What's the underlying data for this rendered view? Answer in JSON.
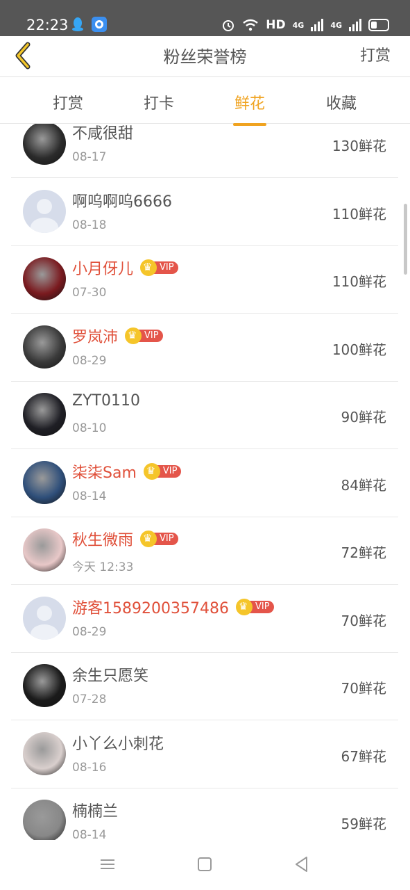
{
  "status": {
    "time": "22:23",
    "hd": "HD",
    "net1": "4G",
    "net2": "4G"
  },
  "header": {
    "title": "粉丝荣誉榜",
    "action": "打赏"
  },
  "tabs": [
    "打赏",
    "打卡",
    "鲜花",
    "收藏"
  ],
  "active_tab": 2,
  "vip_label": "VIP",
  "rows": [
    {
      "name": "不咸很甜",
      "date": "08-17",
      "count": "130鲜花",
      "vip": false,
      "avatar_color": "#2b2b2b"
    },
    {
      "name": "啊呜啊呜6666",
      "date": "08-18",
      "count": "110鲜花",
      "vip": false,
      "avatar_color": "#d6dcea"
    },
    {
      "name": "小月伢儿",
      "date": "07-30",
      "count": "110鲜花",
      "vip": true,
      "avatar_color": "#7a1a1f"
    },
    {
      "name": "罗岚沛",
      "date": "08-29",
      "count": "100鲜花",
      "vip": true,
      "avatar_color": "#3a3a3a"
    },
    {
      "name": "ZYT0110",
      "date": "08-10",
      "count": "90鲜花",
      "vip": false,
      "avatar_color": "#1f1f25"
    },
    {
      "name": "柒柒Sam",
      "date": "08-14",
      "count": "84鲜花",
      "vip": true,
      "avatar_color": "#2f4f7a"
    },
    {
      "name": "秋生微雨",
      "date": "今天 12:33",
      "count": "72鲜花",
      "vip": true,
      "avatar_color": "#e8c8c8"
    },
    {
      "name": "游客1589200357486",
      "date": "08-29",
      "count": "70鲜花",
      "vip": true,
      "avatar_color": "#d6dcea"
    },
    {
      "name": "余生只愿笑",
      "date": "07-28",
      "count": "70鲜花",
      "vip": false,
      "avatar_color": "#1b1b1b"
    },
    {
      "name": "小丫么小刺花",
      "date": "08-16",
      "count": "67鲜花",
      "vip": false,
      "avatar_color": "#d9cfcd"
    },
    {
      "name": "楠楠兰",
      "date": "08-14",
      "count": "59鲜花",
      "vip": false,
      "avatar_color": "#888888"
    }
  ]
}
